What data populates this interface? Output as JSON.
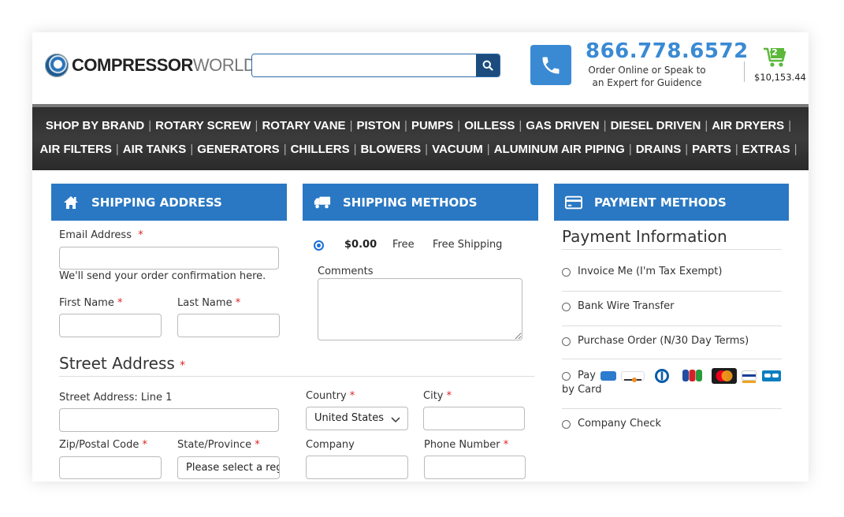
{
  "header": {
    "logo_bold": "COMPRESSOR",
    "logo_thin": "WORLD",
    "search_placeholder": "",
    "phone_number": "866.778.6572",
    "phone_sub": "Order Online or Speak to an Expert for Guidence",
    "cart_count": "2",
    "cart_total": "$10,153.44"
  },
  "nav": {
    "row1": [
      "SHOP BY BRAND",
      "ROTARY SCREW",
      "ROTARY VANE",
      "PISTON",
      "PUMPS",
      "OILLESS",
      "GAS DRIVEN",
      "DIESEL DRIVEN",
      "AIR DRYERS"
    ],
    "row2": [
      "AIR FILTERS",
      "AIR TANKS",
      "GENERATORS",
      "CHILLERS",
      "BLOWERS",
      "VACUUM",
      "ALUMINUM AIR PIPING",
      "DRAINS",
      "PARTS",
      "EXTRAS"
    ]
  },
  "shipping_address": {
    "title": "SHIPPING ADDRESS",
    "email_label": "Email Address",
    "email_value": "",
    "email_note": "We'll send your order confirmation here.",
    "first_name_label": "First Name",
    "last_name_label": "Last Name",
    "street_title": "Street Address",
    "street_line1_label": "Street Address: Line 1",
    "zip_label": "Zip/Postal Code",
    "state_label": "State/Province",
    "state_value": "Please select a reg",
    "country_label": "Country",
    "country_value": "United States",
    "city_label": "City",
    "company_label": "Company",
    "phone_label": "Phone Number",
    "required_mark": "*"
  },
  "shipping_methods": {
    "title": "SHIPPING METHODS",
    "price": "$0.00",
    "method": "Free",
    "carrier": "Free Shipping",
    "comments_label": "Comments"
  },
  "payment_methods": {
    "title": "PAYMENT METHODS",
    "heading": "Payment Information",
    "options": [
      "Invoice Me (I'm Tax Exempt)",
      "Bank Wire Transfer",
      "Purchase Order (N/30 Day Terms)",
      "Pay",
      "Company Check"
    ],
    "pay_by_card_suffix": "by Card",
    "card_brands": [
      "amex-icon",
      "discover-icon",
      "diners-icon",
      "jcb-icon",
      "mastercard-icon",
      "visa-icon",
      "cb-icon"
    ]
  },
  "colors": {
    "accent": "#2a78c3",
    "phone": "#3a8ad3",
    "required": "#dd2222"
  }
}
